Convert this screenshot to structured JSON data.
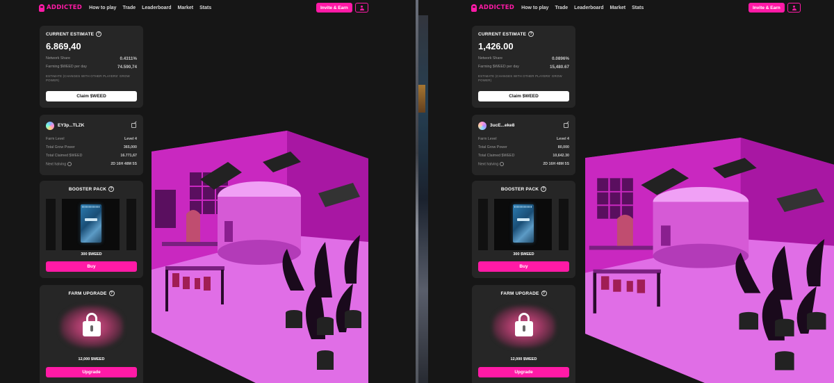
{
  "panes": [
    {
      "nav": {
        "logo": "ADDICTED",
        "links": [
          "How to play",
          "Trade",
          "Leaderboard",
          "Market",
          "Stats"
        ],
        "invite_label": "Invite & Earn"
      },
      "estimate": {
        "title": "CURRENT ESTIMATE",
        "value": "6.869,40",
        "network_share_label": "Network Share",
        "network_share": "0.4311%",
        "farming_label": "Farming $WEED per day",
        "farming": "74.590,74",
        "note": "ESTIMATE (CHANGES WITH OTHER PLAYERS' GROW POWER)",
        "claim_label": "Claim $WEED"
      },
      "profile": {
        "wallet": "EY3p...TLZK",
        "rows": [
          {
            "label": "Farm Level",
            "value": "Level 4"
          },
          {
            "label": "Total Grow Power",
            "value": "365,000"
          },
          {
            "label": "Total Claimed $WEED",
            "value": "16.771,67"
          },
          {
            "label": "Next halving",
            "value": "2D 16H 48M 5S"
          }
        ]
      },
      "booster": {
        "title": "BOOSTER PACK",
        "price": "300 $WEED",
        "buy_label": "Buy"
      },
      "upgrade": {
        "title": "FARM UPGRADE",
        "price": "12,000 $WEED",
        "button_label": "Upgrade"
      }
    },
    {
      "nav": {
        "logo": "ADDICTED",
        "links": [
          "How to play",
          "Trade",
          "Leaderboard",
          "Market",
          "Stats"
        ],
        "invite_label": "Invite & Earn"
      },
      "estimate": {
        "title": "CURRENT ESTIMATE",
        "value": "1,426.00",
        "network_share_label": "Network Share",
        "network_share": "0.0896%",
        "farming_label": "Farming $WEED per day",
        "farming": "15,480.67",
        "note": "ESTIMATE (CHANGES WITH OTHER PLAYERS' GROW POWER)",
        "claim_label": "Claim $WEED"
      },
      "profile": {
        "wallet": "3ucE...eke8",
        "rows": [
          {
            "label": "Farm Level",
            "value": "Level 4"
          },
          {
            "label": "Total Grow Power",
            "value": "80,000"
          },
          {
            "label": "Total Claimed $WEED",
            "value": "10,642.30"
          },
          {
            "label": "Next halving",
            "value": "2D 16H 48M 5S"
          }
        ]
      },
      "booster": {
        "title": "BOOSTER PACK",
        "price": "300 $WEED",
        "buy_label": "Buy"
      },
      "upgrade": {
        "title": "FARM UPGRADE",
        "price": "12,000 $WEED",
        "button_label": "Upgrade"
      }
    }
  ],
  "colors": {
    "accent": "#ff1aa6",
    "card": "#262626",
    "background": "#161616"
  },
  "icons": [
    "logo-icon",
    "user-icon",
    "info-icon",
    "edit-icon",
    "clock-icon",
    "lock-icon"
  ]
}
